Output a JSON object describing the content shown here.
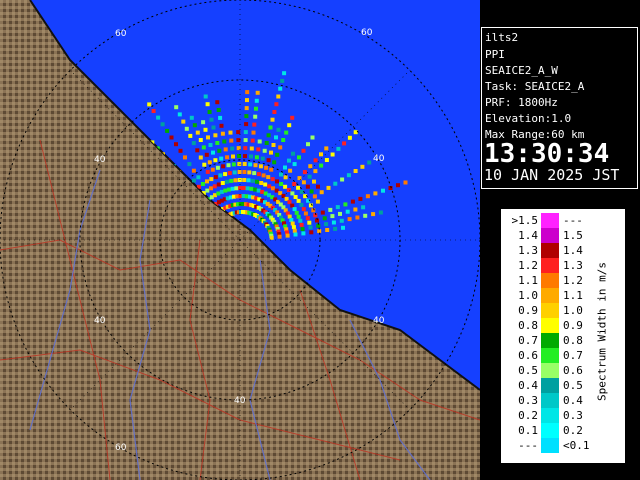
{
  "info": {
    "site": "ilts2",
    "product": "PPI",
    "scan_name": "SEAICE2_A_W",
    "task": "Task: SEAICE2_A",
    "prf": "PRF: 1800Hz",
    "elevation": "Elevation:1.0",
    "max_range": "Max Range:60 km",
    "time": "13:30:34",
    "date": "10 JAN 2025 JST"
  },
  "legend": {
    "title": "Spectrum Width in m/s",
    "rows": [
      {
        "low": ">1.5",
        "high": "---",
        "color": "#ff22ff"
      },
      {
        "low": "1.4",
        "high": "1.5",
        "color": "#cc00cc"
      },
      {
        "low": "1.3",
        "high": "1.4",
        "color": "#b00000"
      },
      {
        "low": "1.2",
        "high": "1.3",
        "color": "#ff2020"
      },
      {
        "low": "1.1",
        "high": "1.2",
        "color": "#ff7a00"
      },
      {
        "low": "1.0",
        "high": "1.1",
        "color": "#ffaa00"
      },
      {
        "low": "0.9",
        "high": "1.0",
        "color": "#ffd000"
      },
      {
        "low": "0.8",
        "high": "0.9",
        "color": "#ffff00"
      },
      {
        "low": "0.7",
        "high": "0.8",
        "color": "#00aa00"
      },
      {
        "low": "0.6",
        "high": "0.7",
        "color": "#22ee22"
      },
      {
        "low": "0.5",
        "high": "0.6",
        "color": "#99ff66"
      },
      {
        "low": "0.4",
        "high": "0.5",
        "color": "#00a0a0"
      },
      {
        "low": "0.3",
        "high": "0.4",
        "color": "#00c8c8"
      },
      {
        "low": "0.2",
        "high": "0.3",
        "color": "#00e6e6"
      },
      {
        "low": "0.1",
        "high": "0.2",
        "color": "#00ffff"
      },
      {
        "low": "---",
        "high": "<0.1",
        "color": "#00e0ff"
      }
    ]
  },
  "map": {
    "range_ring_labels": [
      "40",
      "60"
    ],
    "colors": {
      "sea": "#1540ff",
      "land": "#8b7355",
      "ring": "#000000",
      "roads": "#c03020",
      "rivers": "#6070d0"
    }
  }
}
